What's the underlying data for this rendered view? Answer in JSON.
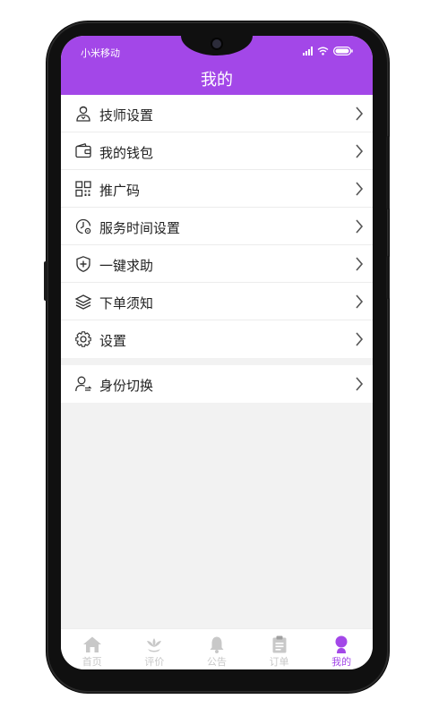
{
  "status_bar": {
    "carrier": "小米移动"
  },
  "header": {
    "title": "我的"
  },
  "menu": [
    {
      "label": "技师设置",
      "icon": "technician-icon"
    },
    {
      "label": "我的钱包",
      "icon": "wallet-icon"
    },
    {
      "label": "推广码",
      "icon": "qr-code-icon"
    },
    {
      "label": "服务时间设置",
      "icon": "clock-settings-icon"
    },
    {
      "label": "一键求助",
      "icon": "shield-plus-icon"
    },
    {
      "label": "下单须知",
      "icon": "layers-icon"
    },
    {
      "label": "设置",
      "icon": "gear-icon"
    }
  ],
  "switch_identity": {
    "label": "身份切换",
    "icon": "user-switch-icon"
  },
  "tabs": [
    {
      "label": "首页",
      "icon": "home-icon"
    },
    {
      "label": "评价",
      "icon": "lotus-icon"
    },
    {
      "label": "公告",
      "icon": "bell-icon"
    },
    {
      "label": "订单",
      "icon": "clipboard-icon"
    },
    {
      "label": "我的",
      "icon": "user-icon",
      "active": true
    }
  ],
  "colors": {
    "accent": "#a347e8",
    "tab_inactive": "#c8c8c8",
    "background": "#f2f2f2"
  }
}
